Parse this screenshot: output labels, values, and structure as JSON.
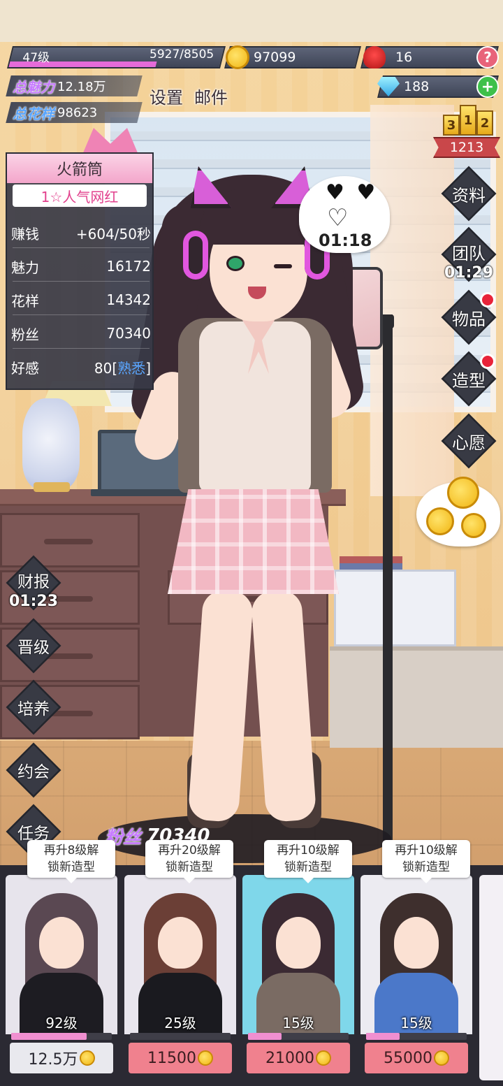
{
  "hud": {
    "level": "47级",
    "exp": "5927/8505",
    "exp_progress": 0.697,
    "coins": "97099",
    "roses": "16",
    "diamonds": "188",
    "help_label": "?",
    "plus_label": "+",
    "charm_label": "总魅力",
    "charm_value": "12.18万",
    "pattern_label": "总花样",
    "pattern_value": "98623",
    "settings": "设置",
    "mail": "邮件",
    "podium": [
      "3",
      "1",
      "2"
    ],
    "rank": "1213",
    "colors": {
      "accent_pink": "#e56bd9",
      "charm_purple": "#c77bff",
      "pattern_blue": "#5aa6ff",
      "panel_dark": "#383a46"
    }
  },
  "character": {
    "name": "火箭筒",
    "title": "1☆人气网红",
    "stats": [
      {
        "label": "赚钱",
        "value": "+604/50秒"
      },
      {
        "label": "魅力",
        "value": "16172"
      },
      {
        "label": "花样",
        "value": "14342"
      },
      {
        "label": "粉丝",
        "value": "70340"
      }
    ],
    "affinity_label": "好感",
    "affinity_value": "80",
    "affinity_level": "熟悉",
    "bracket_open": "[",
    "bracket_close": "]"
  },
  "bubbles": {
    "heart_timer": "01:18",
    "heart_icons": "♥ ♥",
    "hand_icon": "♡"
  },
  "right_menu": [
    {
      "label": "资料",
      "timer": "",
      "badge": false,
      "icon": "profile-icon"
    },
    {
      "label": "团队",
      "timer": "01:29",
      "badge": false,
      "icon": "team-icon"
    },
    {
      "label": "物品",
      "timer": "",
      "badge": true,
      "icon": "items-icon"
    },
    {
      "label": "造型",
      "timer": "",
      "badge": true,
      "icon": "style-icon"
    },
    {
      "label": "心愿",
      "timer": "",
      "badge": false,
      "icon": "wish-icon"
    }
  ],
  "left_menu": [
    {
      "label": "财报",
      "timer": "01:23"
    },
    {
      "label": "晋级",
      "timer": ""
    },
    {
      "label": "培养",
      "timer": ""
    },
    {
      "label": "约会",
      "timer": ""
    },
    {
      "label": "任务",
      "timer": ""
    }
  ],
  "fans_banner": {
    "label": "粉丝",
    "value": "70340"
  },
  "outfits": [
    {
      "tip_line1": "再升8级解",
      "tip_line2": "锁新造型",
      "level": "92级",
      "price": "12.5万",
      "progress": 0.75,
      "state": "locked",
      "bg": "#e7e4ec",
      "hair": "#5a4852",
      "outfit": "#1d1c22"
    },
    {
      "tip_line1": "再升20级解",
      "tip_line2": "锁新造型",
      "level": "25级",
      "price": "11500",
      "progress": 0.0,
      "state": "buy",
      "bg": "#e9e6ee",
      "hair": "#6b3f36",
      "outfit": "#1a1a1f"
    },
    {
      "tip_line1": "再升10级解",
      "tip_line2": "锁新造型",
      "level": "15级",
      "price": "21000",
      "progress": 0.33,
      "state": "buy",
      "bg": "#7fd7ea",
      "hair": "#3b2a33",
      "outfit": "#7a6b63"
    },
    {
      "tip_line1": "再升10级解",
      "tip_line2": "锁新造型",
      "level": "15级",
      "price": "55000",
      "progress": 0.33,
      "state": "buy",
      "bg": "#ecebf1",
      "hair": "#3e2f2d",
      "outfit": "#4b78c9"
    }
  ]
}
